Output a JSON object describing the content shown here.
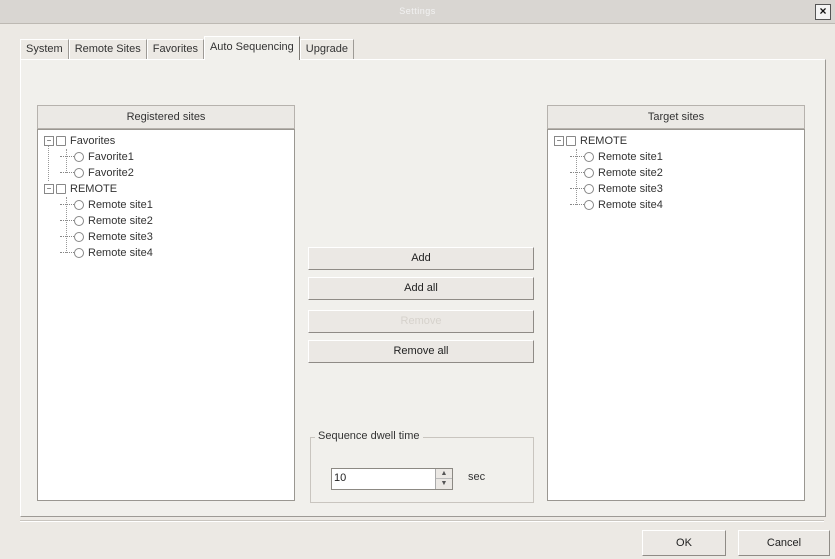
{
  "window": {
    "title": "Settings"
  },
  "tabs": [
    {
      "label": "System"
    },
    {
      "label": "Remote Sites"
    },
    {
      "label": "Favorites"
    },
    {
      "label": "Auto Sequencing"
    },
    {
      "label": "Upgrade"
    }
  ],
  "active_tab": "Auto Sequencing",
  "registered": {
    "header": "Registered sites",
    "groups": [
      {
        "label": "Favorites",
        "items": [
          "Favorite1",
          "Favorite2"
        ]
      },
      {
        "label": "REMOTE",
        "items": [
          "Remote site1",
          "Remote site2",
          "Remote site3",
          "Remote site4"
        ]
      }
    ]
  },
  "target": {
    "header": "Target sites",
    "groups": [
      {
        "label": "REMOTE",
        "items": [
          "Remote site1",
          "Remote site2",
          "Remote site3",
          "Remote site4"
        ]
      }
    ]
  },
  "actions": {
    "add": "Add",
    "add_all": "Add all",
    "remove": "Remove",
    "remove_all": "Remove all"
  },
  "dwell": {
    "title": "Sequence dwell time",
    "value": "10",
    "unit": "sec"
  },
  "dialog": {
    "ok": "OK",
    "cancel": "Cancel"
  },
  "icons": {
    "close": "close-icon",
    "tree_expander": "minus-expander-icon",
    "site": "site-icon",
    "group": "folder-icon",
    "spin_up": "arrow-up-icon",
    "spin_down": "arrow-down-icon"
  }
}
